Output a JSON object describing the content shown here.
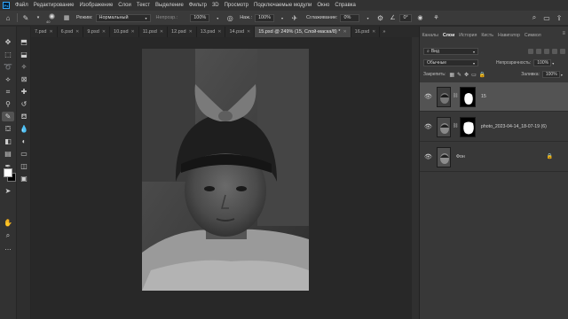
{
  "menubar": {
    "logo": "Ps",
    "items": [
      "Файл",
      "Редактирование",
      "Изображение",
      "Слои",
      "Текст",
      "Выделение",
      "Фильтр",
      "3D",
      "Просмотр",
      "Подключаемые модули",
      "Окно",
      "Справка"
    ]
  },
  "options": {
    "brush_size": "40",
    "mode_label": "Режим:",
    "mode_value": "Нормальный",
    "opacity_label": "Непрозр.:",
    "opacity_value": "100%",
    "pressure_label": "Наж.:",
    "pressure_value": "100%",
    "smoothing_label": "Сглаживание:",
    "smoothing_value": "0%",
    "angle_value": "0°"
  },
  "tabs": [
    {
      "label": "7.psd",
      "active": false
    },
    {
      "label": "6.psd",
      "active": false
    },
    {
      "label": "9.psd",
      "active": false
    },
    {
      "label": "10.psd",
      "active": false
    },
    {
      "label": "11.psd",
      "active": false
    },
    {
      "label": "12.psd",
      "active": false
    },
    {
      "label": "13.psd",
      "active": false
    },
    {
      "label": "14.psd",
      "active": false
    },
    {
      "label": "15.psd @ 249% (15, Слой-маска/8) *",
      "active": true
    },
    {
      "label": "16.psd",
      "active": false
    }
  ],
  "panel": {
    "tabs": [
      "Каналы",
      "Слои",
      "История",
      "Кисть",
      "Навигатор",
      "Символ"
    ],
    "active_tab": "Слои",
    "filter_value": "Вид",
    "blend_mode": "Обычные",
    "opacity_label": "Непрозрачность:",
    "opacity_value": "100%",
    "lock_label": "Закрепить:",
    "fill_label": "Заливка:",
    "fill_value": "100%",
    "layers": [
      {
        "name": "15",
        "has_mask": true,
        "selected": true,
        "locked": false
      },
      {
        "name": "photo_2023-04-14_18-07-19 (6)",
        "has_mask": true,
        "selected": false,
        "locked": false
      },
      {
        "name": "Фон",
        "has_mask": false,
        "selected": false,
        "locked": true
      }
    ]
  },
  "colors": {
    "foreground": "#ffffff",
    "background": "#000000",
    "accent": "#31a8ff"
  }
}
